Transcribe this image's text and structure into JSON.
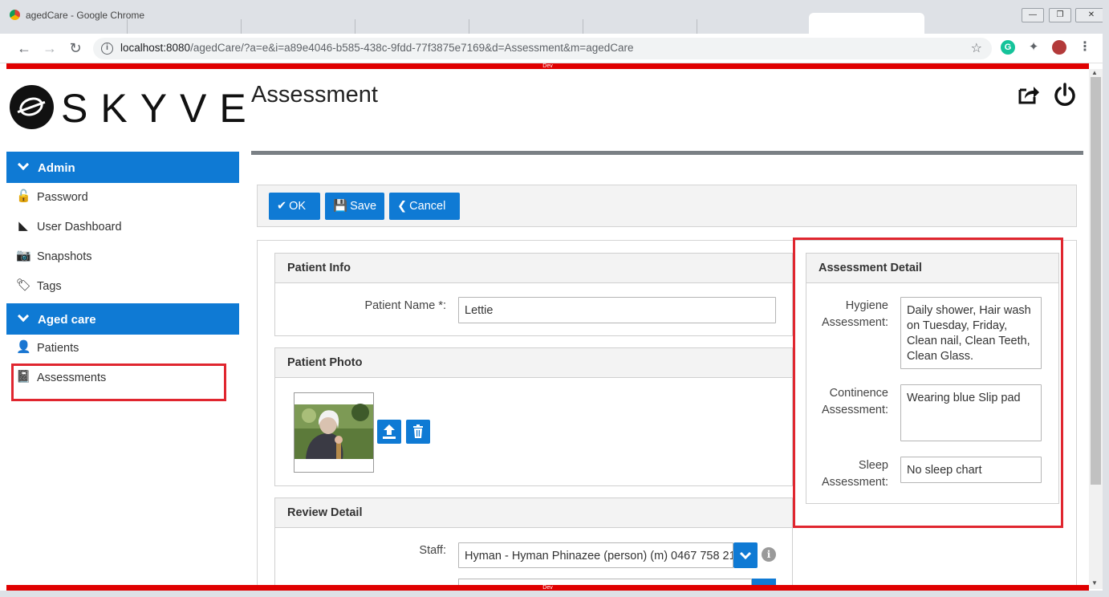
{
  "browser": {
    "window_title": "agedCare - Google Chrome",
    "url_host": "localhost:8080",
    "url_rest": "/agedCare/?a=e&i=a89e4046-b585-438c-9fdd-77f3875e7169&d=Assessment&m=agedCare",
    "window_buttons": [
      "—",
      "❐",
      "✕"
    ],
    "nav_back": "←",
    "nav_forward": "→",
    "nav_reload": "↻",
    "info_glyph": "i",
    "star_glyph": "☆",
    "extension_grammarly": "G",
    "extension_puzzle": "✦",
    "menu_glyph": "⋮"
  },
  "env_banner": {
    "top": "Dev",
    "bottom": "Dev"
  },
  "brand": {
    "name": "SKYVE"
  },
  "sidebar": {
    "groups": [
      {
        "label": "Admin",
        "items": [
          {
            "label": "Password",
            "icon": "unlock-icon",
            "glyph": "🔓"
          },
          {
            "label": "User Dashboard",
            "icon": "area-chart-icon",
            "glyph": "◣"
          },
          {
            "label": "Snapshots",
            "icon": "camera-icon",
            "glyph": "📷"
          },
          {
            "label": "Tags",
            "icon": "tag-icon",
            "glyph": "🏷"
          }
        ]
      },
      {
        "label": "Aged care",
        "items": [
          {
            "label": "Patients",
            "icon": "user-icon",
            "glyph": "👤"
          },
          {
            "label": "Assessments",
            "icon": "book-icon",
            "glyph": "📓"
          }
        ]
      }
    ]
  },
  "page": {
    "title": "Assessment"
  },
  "actions": {
    "ok": {
      "glyph": "✔",
      "label": "OK"
    },
    "save": {
      "glyph": "💾",
      "label": "Save"
    },
    "cancel": {
      "glyph": "❮",
      "label": "Cancel"
    }
  },
  "patient_info": {
    "heading": "Patient Info",
    "name_label": "Patient Name *:",
    "name_value": "Lettie"
  },
  "patient_photo": {
    "heading": "Patient Photo",
    "upload_glyph": "⤒",
    "delete_glyph": "🗑"
  },
  "review_detail": {
    "heading": "Review Detail",
    "staff_label": "Staff:",
    "staff_value": "Hyman - Hyman Phinazee (person) (m) 0467 758 21",
    "info_glyph": "i"
  },
  "assessment_detail": {
    "heading": "Assessment Detail",
    "hygiene_label_1": "Hygiene",
    "hygiene_label_2": "Assessment:",
    "hygiene_value": "Daily shower, Hair wash on Tuesday, Friday, Clean nail, Clean Teeth, Clean Glass.",
    "continence_label_1": "Continence",
    "continence_label_2": "Assessment:",
    "continence_value": "Wearing blue Slip pad",
    "sleep_label_1": "Sleep",
    "sleep_label_2": "Assessment:",
    "sleep_value": "No sleep chart"
  },
  "colors": {
    "accent": "#0f7ad4",
    "highlight": "#e0262f",
    "env_banner": "#e00000"
  }
}
